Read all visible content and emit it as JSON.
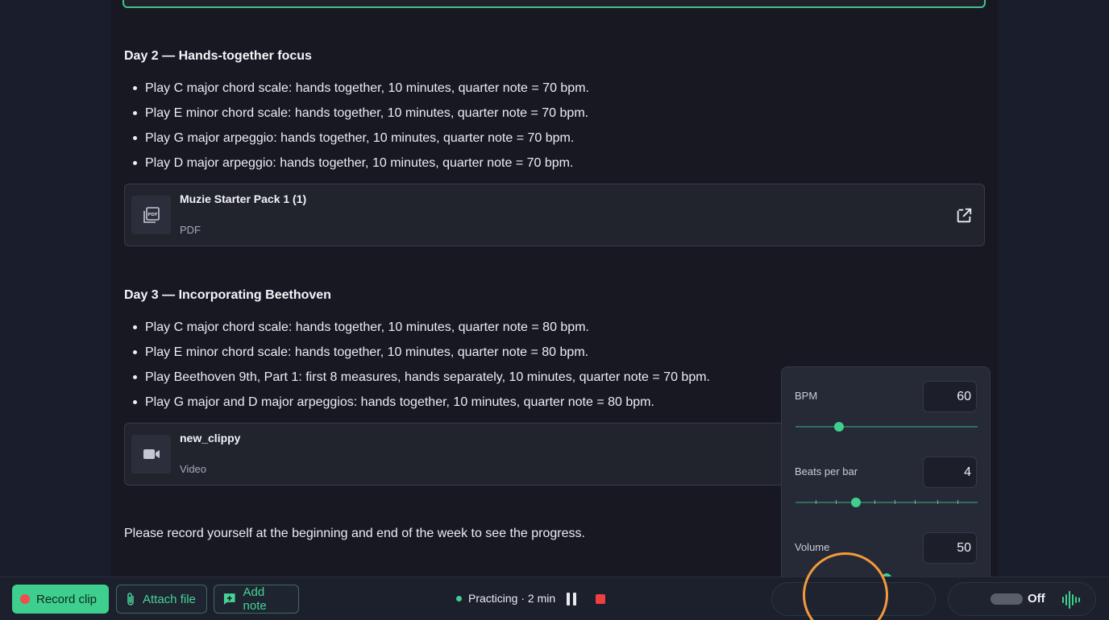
{
  "day2": {
    "heading": "Day 2 — Hands-together focus",
    "tasks": [
      "Play C major chord scale: hands together, 10 minutes, quarter note = 70 bpm.",
      "Play E minor chord scale: hands together, 10 minutes, quarter note = 70 bpm.",
      "Play G major arpeggio: hands together, 10 minutes, quarter note = 70 bpm.",
      "Play D major arpeggio: hands together, 10 minutes, quarter note = 70 bpm."
    ],
    "attachment": {
      "title": "Muzie Starter Pack 1 (1)",
      "type": "PDF",
      "icon": "pdf-icon"
    }
  },
  "day3": {
    "heading": "Day 3 — Incorporating Beethoven",
    "tasks": [
      "Play C major chord scale: hands together, 10 minutes, quarter note = 80 bpm.",
      "Play E minor chord scale: hands together, 10 minutes, quarter note = 80 bpm.",
      "Play Beethoven 9th, Part 1: first 8 measures, hands separately, 10 minutes, quarter note = 70 bpm.",
      "Play G major and D major arpeggios: hands together, 10 minutes, quarter note = 80 bpm."
    ],
    "attachment": {
      "title": "new_clippy",
      "type": "Video",
      "icon": "video-camera-icon"
    }
  },
  "note": "Please record yourself at the beginning and end of the week to see the progress.",
  "metronome": {
    "bpm": {
      "label": "BPM",
      "value": "60",
      "slider_fraction": 0.24
    },
    "beats": {
      "label": "Beats per bar",
      "value": "4",
      "slider_fraction": 0.33
    },
    "volume": {
      "label": "Volume",
      "value": "50",
      "slider_fraction": 0.5
    }
  },
  "bottom_bar": {
    "record_label": "Record clip",
    "attach_label": "Attach file",
    "note_label": "Add note",
    "status": "Practicing · 2 min",
    "toggle_label": "Off"
  },
  "colors": {
    "accent": "#3ecf8e",
    "record_dot": "#ef4f4f",
    "stop": "#ef4040",
    "cursor_ring": "#f59a3a"
  }
}
